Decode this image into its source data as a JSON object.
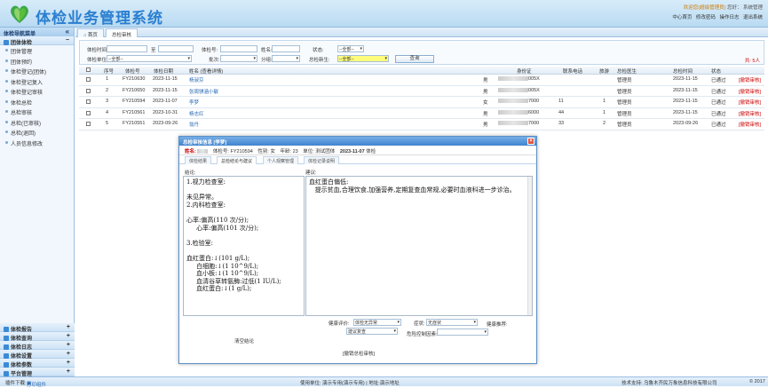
{
  "header": {
    "title": "体检业务管理系统",
    "user_greeting": "欢迎您(超级管理员)",
    "user_links": "您好：  系统管理",
    "links": [
      "中心首页",
      "修改密码",
      "操作日志",
      "退出系统"
    ]
  },
  "sidebar": {
    "title": "体检导航菜单",
    "group_open": "团体体检",
    "items": [
      "团体管理",
      "团体预约",
      "体检登记(团体)",
      "体检登记复入",
      "体检登记审核",
      "体检总检",
      "总检审核",
      "总检(已审核)",
      "总检(退回)",
      "人员信息修改"
    ],
    "bottom_groups": [
      "体检报告",
      "体检查询",
      "体检日志",
      "体检设置",
      "体检参数",
      "平台管理"
    ]
  },
  "tabs": [
    "首页",
    "总检审核"
  ],
  "query": {
    "labels": {
      "exam_date": "体检时间:",
      "to": "至",
      "unit": "体检单位:",
      "exam_no": "体检号:",
      "name": "姓名:",
      "status": "状态:",
      "batch": "批次:",
      "group": "分组:",
      "new_flag": "总检新生:"
    },
    "unit_value": "--全部--",
    "batch_value": "",
    "group_value": "",
    "status_value": "--全部--",
    "new_value": "--全部--",
    "query_btn": "查询",
    "count": "共: 5人"
  },
  "table": {
    "headers": [
      "序号",
      "体检号",
      "体检日期",
      "姓名 (查看详情)",
      "",
      "身份证",
      "联系电话",
      "旅游",
      "总检医生",
      "总检时间",
      "状态",
      ""
    ],
    "rows": [
      {
        "no": "1",
        "id": "FY210630",
        "date": "2023-11-15",
        "name": "杨淑芬",
        "sex": "男",
        "idcard": "005X",
        "phone": "",
        "trip": "",
        "doctor": "管理员",
        "time": "2023-11-15",
        "status": "已通过",
        "op": "[撤销审核]"
      },
      {
        "no": "2",
        "id": "FY210650",
        "date": "2023-11-15",
        "name": "张周骐涵小敏",
        "sex": "男",
        "idcard": "005X",
        "phone": "",
        "trip": "",
        "doctor": "管理员",
        "time": "2023-11-15",
        "status": "已通过",
        "op": "[撤销审核]"
      },
      {
        "no": "3",
        "id": "FY210594",
        "date": "2023-11-07",
        "name": "李梦",
        "sex": "女",
        "idcard": "7000",
        "phone": "11",
        "trip": "1",
        "doctor": "管理员",
        "time": "2023-11-15",
        "status": "已通过",
        "op": "[撤销审核]"
      },
      {
        "no": "4",
        "id": "FY210561",
        "date": "2023-10-31",
        "name": "杨志红",
        "sex": "男",
        "idcard": "6000",
        "phone": "44",
        "trip": "1",
        "doctor": "管理员",
        "time": "2023-11-15",
        "status": "已通过",
        "op": "[撤销审核]"
      },
      {
        "no": "5",
        "id": "FY210551",
        "date": "2023-09-26",
        "name": "翁丹",
        "sex": "男",
        "idcard": "7000",
        "phone": "33",
        "trip": "2",
        "doctor": "管理员",
        "time": "2023-09-26",
        "status": "已通过",
        "op": "[撤销审核]"
      }
    ]
  },
  "dialog": {
    "title": "总检审核信息 [李梦]",
    "info": {
      "name_label": "姓名:",
      "exam_label": "体检号:",
      "exam_no": "FY210594",
      "sex_label": "性别:",
      "sex": "女",
      "age_label": "年龄:",
      "age": "23",
      "unit_label": "单位:",
      "unit": "测试团体",
      "date": "2023-11-07",
      "date_suffix": "体检"
    },
    "tabs": [
      "体检结果",
      "总检结论与建议",
      "个人观察管理",
      "体检记录说明"
    ],
    "left_label": "结论:",
    "right_label": "建议:",
    "conclusion": "1.视力检查室:\n\n未见异常。\n2.内科检查室:\n\n心率:偏高(110 次/分);\n     心率:偏高(101 次/分);\n\n3.检验室:\n\n血红蛋白:↓(101 g/L);\n     白细胞:↓(1 10^9/L);\n     血小板:↓(1 10^9/L);\n     血清谷草转氨酶:过低(1 IU/L);\n     血红蛋白:↓(1 g/L);",
    "advice": "血红蛋白偏低:\n   提示贫血,合理饮食,加强营养,定期复查血常规,必要时血液科进一步诊治。",
    "clear_link": "清空结论",
    "health_eval": "健康评价:",
    "health_eval_value": "体检无异常",
    "advice_sel": "建议复查",
    "symptom": "症状:",
    "symptom_value": "无症状",
    "health_recommend": "健康推荐:",
    "risk": "危险控制因素:",
    "risk_value": "",
    "bottom_link": "[撤销总检审核]"
  },
  "footer": {
    "plugin": "插件下载:",
    "plugin_link": "打印组件",
    "unit": "使用单位: 演示专用(演示专用) | 地址:演示地址",
    "support": "技术支持: 乌鲁木齐民万象信息科技有限公司",
    "copyright": "© 2017"
  },
  "colors": {
    "brand": "#2a7fd0",
    "link": "#2a6ab3",
    "alert": "#cc0000"
  }
}
